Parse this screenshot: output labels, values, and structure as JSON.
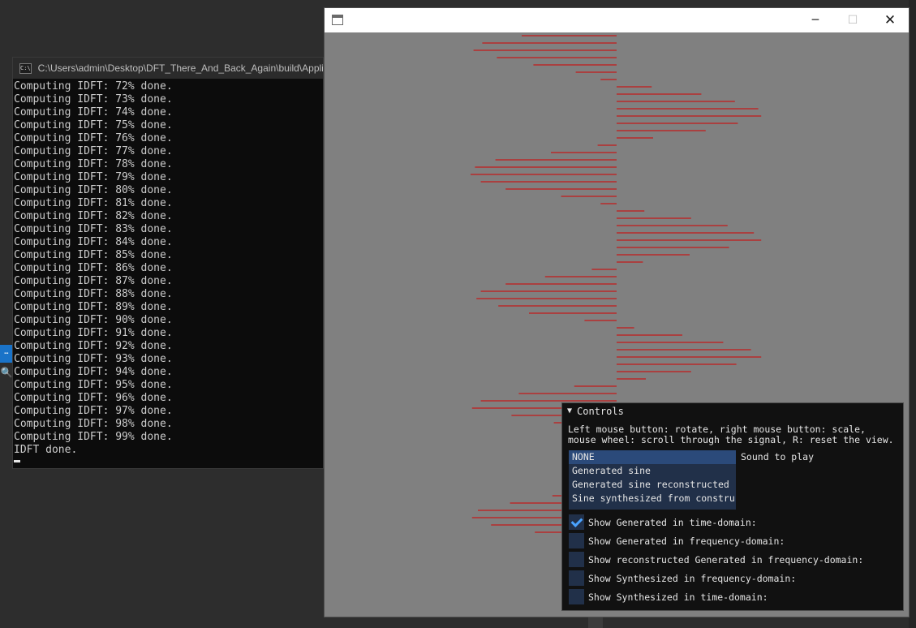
{
  "console": {
    "title": "C:\\Users\\admin\\Desktop\\DFT_There_And_Back_Again\\build\\Applic",
    "lines": [
      "Computing IDFT: 72% done.",
      "Computing IDFT: 73% done.",
      "Computing IDFT: 74% done.",
      "Computing IDFT: 75% done.",
      "Computing IDFT: 76% done.",
      "Computing IDFT: 77% done.",
      "Computing IDFT: 78% done.",
      "Computing IDFT: 79% done.",
      "Computing IDFT: 80% done.",
      "Computing IDFT: 81% done.",
      "Computing IDFT: 82% done.",
      "Computing IDFT: 83% done.",
      "Computing IDFT: 84% done.",
      "Computing IDFT: 85% done.",
      "Computing IDFT: 86% done.",
      "Computing IDFT: 87% done.",
      "Computing IDFT: 88% done.",
      "Computing IDFT: 89% done.",
      "Computing IDFT: 90% done.",
      "Computing IDFT: 91% done.",
      "Computing IDFT: 92% done.",
      "Computing IDFT: 93% done.",
      "Computing IDFT: 94% done.",
      "Computing IDFT: 95% done.",
      "Computing IDFT: 96% done.",
      "Computing IDFT: 97% done.",
      "Computing IDFT: 98% done.",
      "Computing IDFT: 99% done.",
      "IDFT done."
    ]
  },
  "app_window": {
    "buttons": {
      "minimize": "─",
      "maximize": "☐",
      "close": "✕"
    }
  },
  "waveform": {
    "color": "#d40000",
    "samples": [
      -0.65,
      -0.92,
      -0.98,
      -0.82,
      -0.57,
      -0.28,
      -0.11,
      0.24,
      0.58,
      0.81,
      0.97,
      0.99,
      0.83,
      0.61,
      0.25,
      -0.13,
      -0.45,
      -0.83,
      -0.97,
      -1.0,
      -0.93,
      -0.76,
      -0.38,
      -0.11,
      0.19,
      0.51,
      0.76,
      0.94,
      0.99,
      0.77,
      0.5,
      0.18,
      -0.17,
      -0.49,
      -0.76,
      -0.93,
      -0.96,
      -0.81,
      -0.6,
      -0.22,
      0.12,
      0.45,
      0.73,
      0.92,
      0.99,
      0.82,
      0.51,
      0.2,
      -0.29,
      -0.67,
      -0.93,
      -0.99,
      -0.72,
      -0.43,
      -0.15,
      0.18,
      0.52,
      0.84,
      0.97,
      0.91,
      0.7,
      0.38,
      -0.13,
      -0.44,
      -0.73,
      -0.95,
      -0.99,
      -0.86,
      -0.56,
      -0.24
    ],
    "show_time_domain": true
  },
  "controls": {
    "header": "Controls",
    "help_line1": "Left mouse button: rotate, right mouse button: scale,",
    "help_line2": "mouse wheel: scroll through the signal, R: reset the view.",
    "sound_label": "Sound to play",
    "sound_options": [
      "NONE",
      "Generated sine",
      "Generated sine reconstructed",
      "Sine synthesized from constru"
    ],
    "sound_selected": "NONE",
    "checkboxes": [
      {
        "label": "Show Generated in time-domain:",
        "checked": true
      },
      {
        "label": "Show Generated in frequency-domain:",
        "checked": false
      },
      {
        "label": "Show reconstructed Generated in frequency-domain:",
        "checked": false
      },
      {
        "label": "Show Synthesized in frequency-domain:",
        "checked": false
      },
      {
        "label": "Show Synthesized in time-domain:",
        "checked": false
      }
    ]
  }
}
